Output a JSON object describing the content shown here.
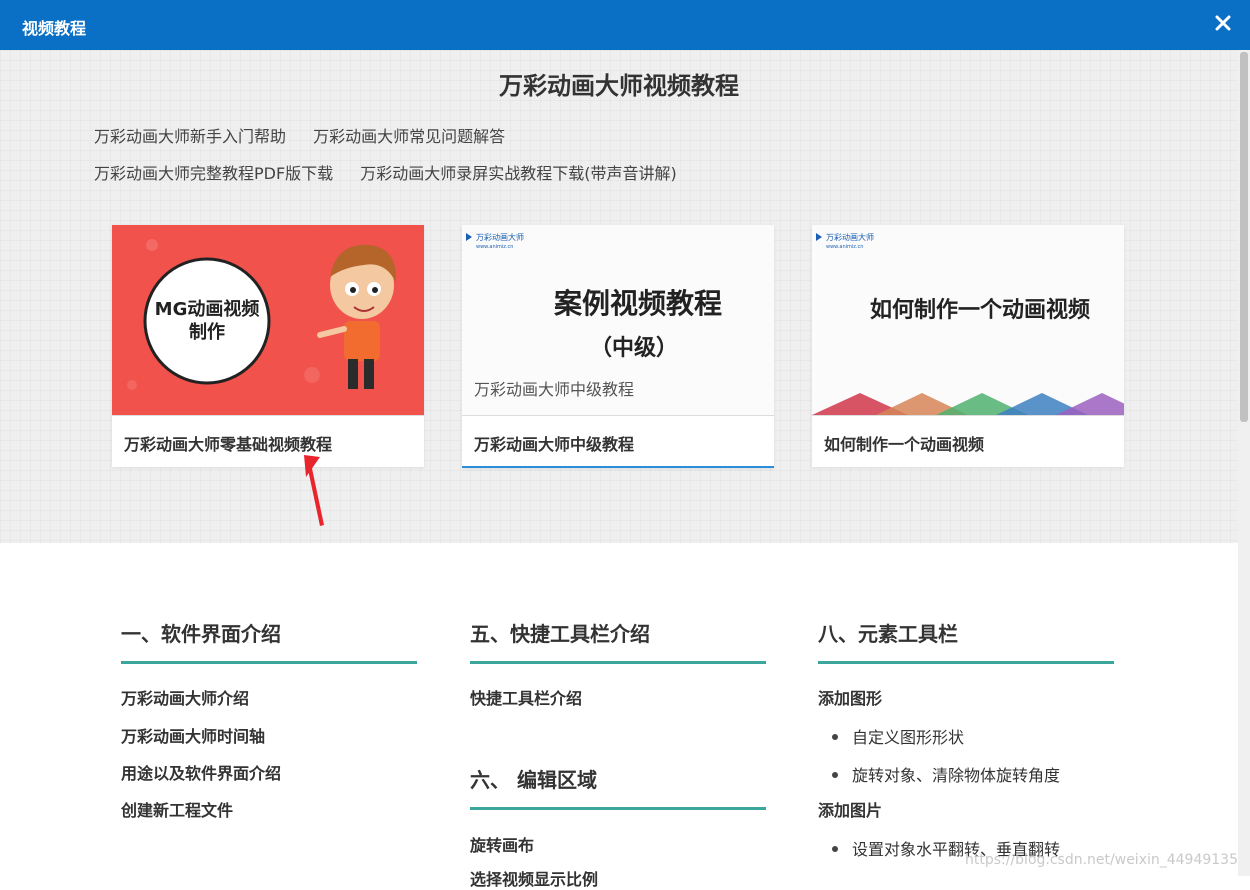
{
  "window": {
    "title": "视频教程",
    "close_icon": "close-icon"
  },
  "page": {
    "title": "万彩动画大师视频教程"
  },
  "links": {
    "row1": [
      "万彩动画大师新手入门帮助",
      "万彩动画大师常见问题解答"
    ],
    "row2": [
      "万彩动画大师完整教程PDF版下载",
      "万彩动画大师录屏实战教程下载(带声音讲解)"
    ]
  },
  "cards": [
    {
      "caption": "万彩动画大师零基础视频教程",
      "thumb_text": "MG动画视频\n制作",
      "thumb_line1": "MG动画视频",
      "thumb_line2": "制作"
    },
    {
      "caption": "万彩动画大师中级教程",
      "brand": "万彩动画大师",
      "brand_url": "www.animiz.cn",
      "heading": "案例视频教程",
      "sub": "（中级）",
      "desc": "万彩动画大师中级教程"
    },
    {
      "caption": "如何制作一个动画视频",
      "brand": "万彩动画大师",
      "brand_url": "www.animiz.cn",
      "heading": "如何制作一个动画视频"
    }
  ],
  "sections": {
    "col1": {
      "title": "一、软件界面介绍",
      "items": [
        "万彩动画大师介绍",
        "万彩动画大师时间轴",
        "用途以及软件界面介绍",
        "创建新工程文件"
      ]
    },
    "col2a": {
      "title": "五、快捷工具栏介绍",
      "items": [
        "快捷工具栏介绍"
      ]
    },
    "col2b": {
      "title": "六、 编辑区域",
      "items": [
        "旋转画布",
        "选择视频显示比例"
      ]
    },
    "col3": {
      "title": "八、元素工具栏",
      "group1": "添加图形",
      "group1_items": [
        "自定义图形形状",
        "旋转对象、清除物体旋转角度"
      ],
      "group2": "添加图片",
      "group2_items": [
        "设置对象水平翻转、垂直翻转"
      ]
    }
  },
  "watermark": "https://blog.csdn.net/weixin_44949135",
  "colors": {
    "titlebar": "#0a70c5",
    "accent_line": "#3ba69b",
    "arrow": "#e8242c"
  }
}
